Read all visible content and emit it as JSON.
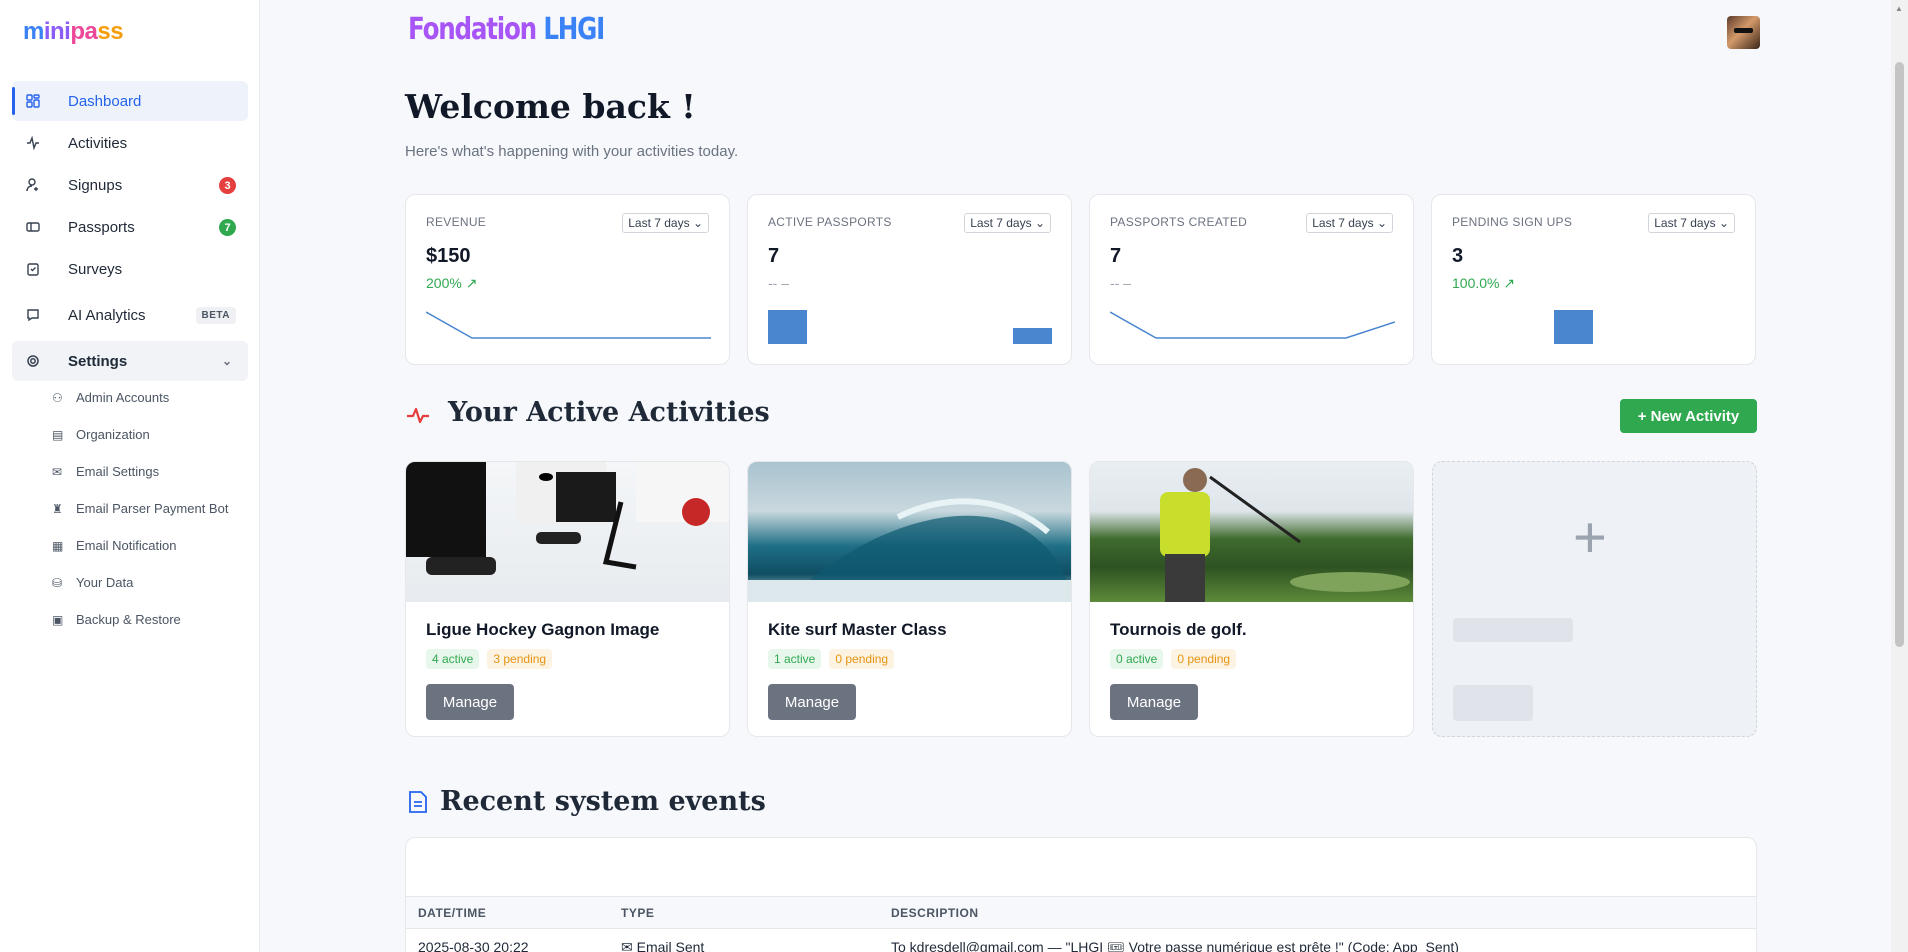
{
  "sidebar": {
    "logo": {
      "p1": "m",
      "p2": "ini",
      "p3": "pa",
      "p4": "ss"
    },
    "items": [
      {
        "label": "Dashboard",
        "icon": "dashboard-icon"
      },
      {
        "label": "Activities",
        "icon": "pulse-icon"
      },
      {
        "label": "Signups",
        "icon": "user-plus-icon",
        "badge": "3"
      },
      {
        "label": "Passports",
        "icon": "ticket-icon",
        "badge": "7"
      },
      {
        "label": "Surveys",
        "icon": "clipboard-icon"
      },
      {
        "label": "AI Analytics",
        "icon": "chat-icon",
        "tag": "BETA"
      },
      {
        "label": "Settings",
        "icon": "gear-icon"
      }
    ],
    "settings_items": [
      {
        "label": "Admin Accounts",
        "icon": "users-icon"
      },
      {
        "label": "Organization",
        "icon": "building-icon"
      },
      {
        "label": "Email Settings",
        "icon": "mail-icon"
      },
      {
        "label": "Email Parser Payment Bot",
        "icon": "robot-icon"
      },
      {
        "label": "Email Notification",
        "icon": "template-icon"
      },
      {
        "label": "Your Data",
        "icon": "database-icon"
      },
      {
        "label": "Backup & Restore",
        "icon": "archive-icon"
      }
    ]
  },
  "header": {
    "org_part1": "Fondation",
    "org_part2": "LHGI"
  },
  "welcome": {
    "title": "Welcome back !",
    "subtitle": "Here's what's happening with your activities today."
  },
  "stats": [
    {
      "label": "REVENUE",
      "period": "Last 7 days",
      "value": "$150",
      "change": "200%",
      "trend": "↗"
    },
    {
      "label": "ACTIVE PASSPORTS",
      "period": "Last 7 days",
      "value": "7",
      "change": "-- –",
      "trend": ""
    },
    {
      "label": "PASSPORTS CREATED",
      "period": "Last 7 days",
      "value": "7",
      "change": "-- –",
      "trend": ""
    },
    {
      "label": "PENDING SIGN UPS",
      "period": "Last 7 days",
      "value": "3",
      "change": "100.0%",
      "trend": "↗"
    }
  ],
  "activities_section": {
    "title": "Your Active Activities",
    "new_button": "+ New Activity"
  },
  "activities": [
    {
      "name": "Ligue Hockey Gagnon Image",
      "active": "4 active",
      "pending": "3 pending",
      "manage": "Manage"
    },
    {
      "name": "Kite surf Master Class",
      "active": "1 active",
      "pending": "0 pending",
      "manage": "Manage"
    },
    {
      "name": "Tournois de golf.",
      "active": "0 active",
      "pending": "0 pending",
      "manage": "Manage"
    }
  ],
  "events": {
    "title": "Recent system events",
    "columns": [
      "DATE/TIME",
      "TYPE",
      "DESCRIPTION"
    ],
    "rows": [
      {
        "datetime": "2025-08-30 20:22",
        "type": "✉ Email Sent",
        "description": "To kdresdell@gmail.com — \"LHGI 🎟 Votre passe numérique est prête !\" (Code: App_Sent)"
      }
    ]
  },
  "colors": {
    "accent": "#2563eb",
    "success": "#2fa84f",
    "danger": "#e53e3e",
    "warning": "#e69410",
    "chart": "#4a86cf"
  }
}
